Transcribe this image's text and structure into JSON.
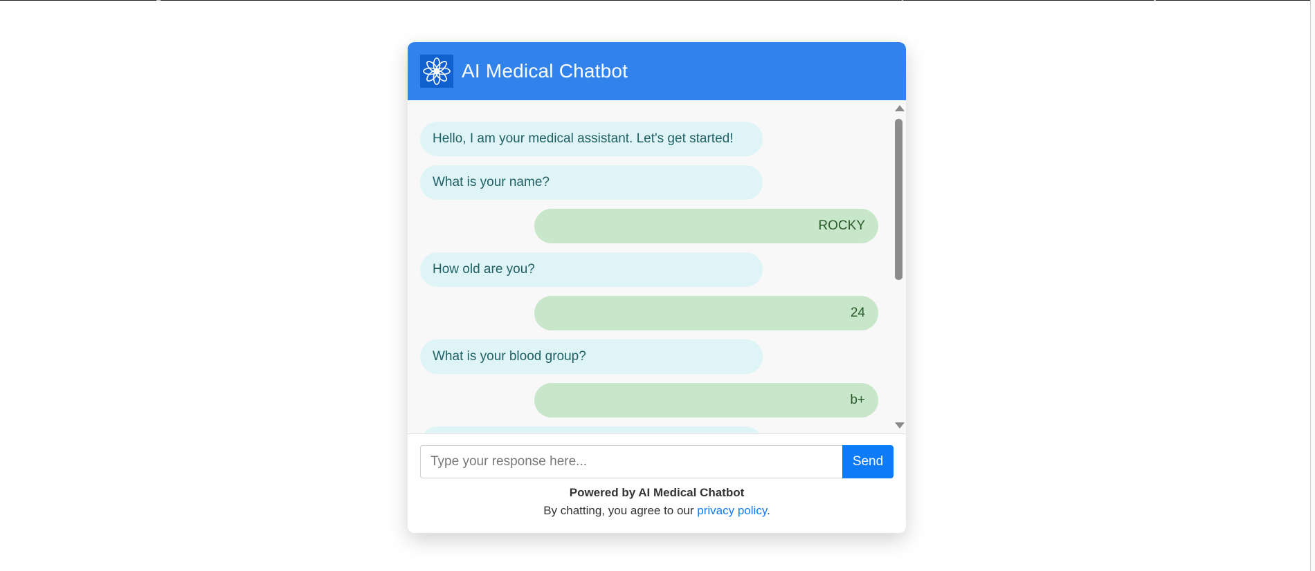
{
  "header": {
    "title": "AI Medical Chatbot",
    "logo_icon": "flower-icon",
    "bg_color": "#3282ec"
  },
  "messages": [
    {
      "sender": "bot",
      "text": "Hello, I am your medical assistant. Let's get started!"
    },
    {
      "sender": "bot",
      "text": "What is your name?"
    },
    {
      "sender": "user",
      "text": "ROCKY"
    },
    {
      "sender": "bot",
      "text": "How old are you?"
    },
    {
      "sender": "user",
      "text": "24"
    },
    {
      "sender": "bot",
      "text": "What is your blood group?"
    },
    {
      "sender": "user",
      "text": "b+"
    },
    {
      "sender": "bot",
      "text": ""
    }
  ],
  "input": {
    "placeholder": "Type your response here...",
    "value": "",
    "send_label": "Send"
  },
  "footer": {
    "powered_by": "Powered by AI Medical Chatbot",
    "agreement_prefix": "By chatting, you agree to our ",
    "privacy_link": "privacy policy",
    "agreement_suffix": "."
  },
  "colors": {
    "bot_bubble": "#dff4f7",
    "user_bubble": "#c8e6c9",
    "accent": "#0d7bf5"
  }
}
